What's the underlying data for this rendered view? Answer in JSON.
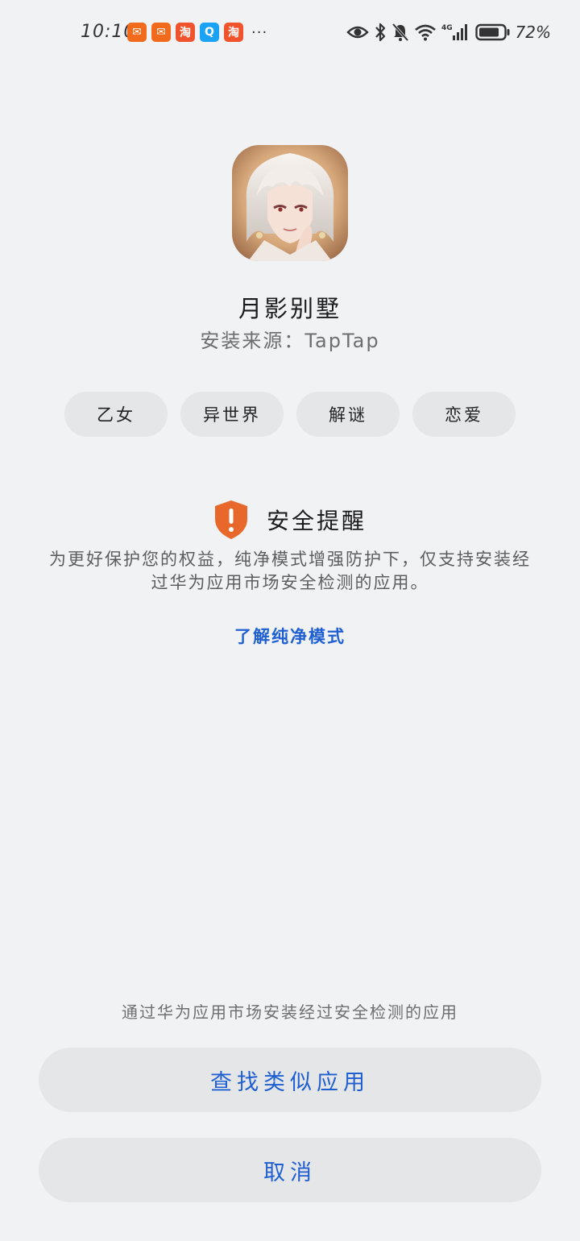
{
  "status_bar": {
    "time": "10:10",
    "notification_icons": [
      {
        "name": "red-envelope-app-icon",
        "glyph": "✉",
        "color": "#f26a1b"
      },
      {
        "name": "red-envelope-app-icon",
        "glyph": "✉",
        "color": "#f26a1b"
      },
      {
        "name": "taobao-app-icon",
        "glyph": "淘",
        "color": "#f0542d"
      },
      {
        "name": "search-app-icon",
        "glyph": "Q",
        "color": "#1aa3f5"
      },
      {
        "name": "taobao-app-icon",
        "glyph": "淘",
        "color": "#f0542d"
      }
    ],
    "more": "···",
    "network": "4G",
    "battery_percent": "72%"
  },
  "app": {
    "name": "月影别墅",
    "install_source": "安装来源：TapTap"
  },
  "tags": [
    "乙女",
    "异世界",
    "解谜",
    "恋爱"
  ],
  "security": {
    "title": "安全提醒",
    "body": "为更好保护您的权益，纯净模式增强防护下，仅支持安装经过华为应用市场安全检测的应用。",
    "learn_more": "了解纯净模式"
  },
  "bottom": {
    "hint": "通过华为应用市场安装经过安全检测的应用",
    "find_similar_label": "查找类似应用",
    "cancel_label": "取消"
  },
  "colors": {
    "background": "#f1f2f4",
    "accent_link": "#1f5fd1",
    "warning_shield": "#e8672a",
    "button_bg": "#e5e6e8"
  }
}
